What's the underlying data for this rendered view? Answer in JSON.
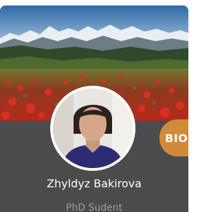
{
  "profile_card": {
    "name": "Zhyldyz Bakirova",
    "role": "PhD Sudent",
    "bio_label": "BIO"
  },
  "colors": {
    "card_bg": "#4b4b4b",
    "accent": "#d18a3a",
    "name_text": "#ffffff",
    "role_text": "#9c9c9c"
  }
}
